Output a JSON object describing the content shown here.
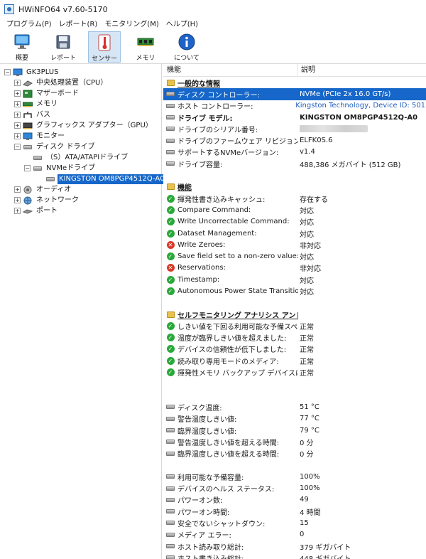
{
  "window": {
    "title": "HWiNFO64 v7.60-5170"
  },
  "menu": [
    "プログラム(P)",
    "レポート(R)",
    "モニタリング(M)",
    "ヘルプ(H)"
  ],
  "toolbar": [
    {
      "label": "概要",
      "icon": "monitor-icon"
    },
    {
      "label": "レポート",
      "icon": "save-disk-icon"
    },
    {
      "label": "センサー",
      "icon": "thermometer-icon"
    },
    {
      "label": "メモリ",
      "icon": "memory-module-icon"
    },
    {
      "label": "について",
      "icon": "info-icon"
    }
  ],
  "tree": {
    "root": "GK3PLUS",
    "items": [
      {
        "label": "中央処理装置（CPU）",
        "icon": "cpu-icon"
      },
      {
        "label": "マザーボード",
        "icon": "motherboard-icon"
      },
      {
        "label": "メモリ",
        "icon": "memory-icon"
      },
      {
        "label": "バス",
        "icon": "bus-icon"
      },
      {
        "label": "グラフィックス アダプター（GPU）",
        "icon": "gpu-icon"
      },
      {
        "label": "モニター",
        "icon": "display-icon"
      },
      {
        "label": "ディスク ドライブ",
        "icon": "disk-drive-icon"
      },
      {
        "label": "（S）ATA/ATAPIドライブ",
        "icon": "disk-drive-icon"
      },
      {
        "label": "NVMeドライブ",
        "icon": "disk-drive-icon"
      },
      {
        "label": "KINGSTON OM8PGP4512Q-A0",
        "icon": "disk-drive-icon"
      },
      {
        "label": "オーディオ",
        "icon": "speaker-icon"
      },
      {
        "label": "ネットワーク",
        "icon": "network-icon"
      },
      {
        "label": "ポート",
        "icon": "port-icon"
      }
    ]
  },
  "columns": {
    "feature": "機能",
    "description": "説明"
  },
  "sections": {
    "general": {
      "title": "一般的な情報",
      "rows": [
        {
          "label": "ディスク コントローラー:",
          "value": "NVMe (PCIe 2x 16.0 GT/s)"
        },
        {
          "label": "ホスト コントローラー:",
          "value": "Kingston Technology, Device ID: 501B"
        },
        {
          "label": "ドライブ モデル:",
          "value": "KINGSTON OM8PGP4512Q-A0"
        },
        {
          "label": "ドライブのシリアル番号:",
          "value": ""
        },
        {
          "label": "ドライブのファームウェア リビジョン:",
          "value": "ELFK0S.6"
        },
        {
          "label": "サポートするNVMeバージョン:",
          "value": "v1.4"
        },
        {
          "label": "ドライブ容量:",
          "value": "488,386 メガバイト (512 GB)"
        }
      ]
    },
    "features": {
      "title": "機能",
      "rows": [
        {
          "label": "揮発性書き込みキャッシュ:",
          "value": "存在する",
          "status": "ok"
        },
        {
          "label": "Compare Command:",
          "value": "対応",
          "status": "ok"
        },
        {
          "label": "Write Uncorrectable Command:",
          "value": "対応",
          "status": "ok"
        },
        {
          "label": "Dataset Management:",
          "value": "対応",
          "status": "ok"
        },
        {
          "label": "Write Zeroes:",
          "value": "非対応",
          "status": "ng"
        },
        {
          "label": "Save field set to a non-zero value:",
          "value": "対応",
          "status": "ok"
        },
        {
          "label": "Reservations:",
          "value": "非対応",
          "status": "ng"
        },
        {
          "label": "Timestamp:",
          "value": "対応",
          "status": "ok"
        },
        {
          "label": "Autonomous Power State Transitions:",
          "value": "対応",
          "status": "ok"
        }
      ]
    },
    "smart": {
      "title": "セルフモニタリング アナリシス アンド ...",
      "rows": [
        {
          "label": "しきい値を下回る利用可能な予備スペ...",
          "value": "正常"
        },
        {
          "label": "温度が臨界しきい値を超えました:",
          "value": "正常"
        },
        {
          "label": "デバイスの信頼性が低下しました:",
          "value": "正常"
        },
        {
          "label": "読み取り専用モードのメディア:",
          "value": "正常"
        },
        {
          "label": "揮発性メモリ バックアップ デバイスに障...",
          "value": "正常"
        }
      ]
    },
    "temps": [
      {
        "label": "ディスク温度:",
        "value": "51 °C"
      },
      {
        "label": "警告温度しきい値:",
        "value": "77 °C"
      },
      {
        "label": "臨界温度しきい値:",
        "value": "79 °C"
      },
      {
        "label": "警告温度しきい値を超える時間:",
        "value": "0 分"
      },
      {
        "label": "臨界温度しきい値を超える時間:",
        "value": "0 分"
      }
    ],
    "health": [
      {
        "label": "利用可能な予備容量:",
        "value": "100%"
      },
      {
        "label": "デバイスのヘルス ステータス:",
        "value": "100%"
      },
      {
        "label": "パワーオン数:",
        "value": "49"
      },
      {
        "label": "パワーオン時間:",
        "value": "4 時間"
      },
      {
        "label": "安全でないシャットダウン:",
        "value": "15"
      },
      {
        "label": "メディア エラー:",
        "value": "0"
      },
      {
        "label": "ホスト読み取り総計:",
        "value": "379 ギガバイト"
      },
      {
        "label": "ホスト書き込み総計:",
        "value": "448 ギガバイト"
      }
    ]
  }
}
